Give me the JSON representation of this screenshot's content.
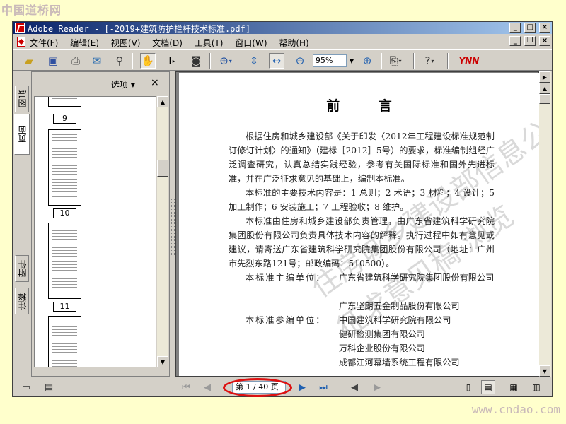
{
  "site_logo": "中国道桥网",
  "site_url": "www.cndao.com",
  "window": {
    "title": "Adobe Reader - [-2019+建筑防护栏杆技术标准.pdf]",
    "min_glyph": "_",
    "max_glyph": "□",
    "close_glyph": "×",
    "restore_glyph": "❐"
  },
  "menu": [
    "文件(F)",
    "编辑(E)",
    "视图(V)",
    "文档(D)",
    "工具(T)",
    "窗口(W)",
    "帮助(H)"
  ],
  "toolbar": {
    "zoom_value": "95%",
    "brand_logo": "YNN"
  },
  "nav_tabs": [
    "图层",
    "页面",
    "附件",
    "注释"
  ],
  "pages_pane": {
    "options_label": "选项",
    "close_glyph": "×",
    "thumb_labels": [
      "9",
      "10",
      "11"
    ]
  },
  "document": {
    "title": "前 言",
    "p1": "根据住房和城乡建设部《关于印发〈2012年工程建设标准规范制订修订计划〉的通知》（建标［2012］5号）的要求，标准编制组经广泛调查研究，认真总结实践经验，参考有关国际标准和国外先进标准，并在广泛征求意见的基础上，编制本标准。",
    "p2": "本标准的主要技术内容是：1 总则；2 术语；3 材料；4 设计；5 加工制作；6 安装施工；7 工程验收；8 维护。",
    "p3": "本标准由住房和城乡建设部负责管理，由广东省建筑科学研究院集团股份有限公司负责具体技术内容的解释。执行过程中如有意见或建议，请寄送广东省建筑科学研究院集团股份有限公司（地址：广州市先烈东路121号；邮政编码：510500）。",
    "chief_label": "本标准主编单位：",
    "chief_units": [
      "广东省建筑科学研究院集团股份有限公司",
      "广东坚朗五金制品股份有限公司"
    ],
    "participant_label": "本标准参编单位：",
    "participant_units": [
      "中国建筑科学研究院有限公司",
      "健研检测集团有限公司",
      "万科企业股份有限公司",
      "成都江河幕墙系统工程有限公司"
    ],
    "watermark_1": "住房城乡建设部信息公开",
    "watermark_2": "征求意见稿 浏览"
  },
  "status": {
    "page_display": "第 1 / 40 页"
  }
}
